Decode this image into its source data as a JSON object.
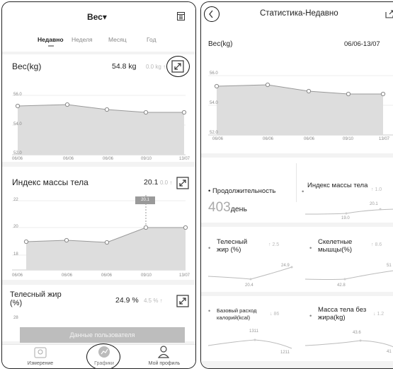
{
  "left": {
    "header": {
      "title": "Вес",
      "title_arrow": "▾"
    },
    "tabs": [
      {
        "label": "Недавно",
        "active": true
      },
      {
        "label": "Неделя",
        "active": false
      },
      {
        "label": "Месяц",
        "active": false
      },
      {
        "label": "Год",
        "active": false
      }
    ],
    "weight_card": {
      "title": "Вес(kg)",
      "value": "54.8 kg",
      "delta": "0.0 kg ↑",
      "y_ticks": [
        "56.0",
        "54.0",
        "52.0"
      ],
      "x_labels": [
        "06/06",
        "06/06",
        "06/06",
        "09/10",
        "13/07"
      ]
    },
    "bmi_card": {
      "title": "Индекс массы тела",
      "value": "20.1",
      "delta": "0.0 ↑",
      "tooltip": "20.1",
      "y_ticks": [
        "22",
        "20",
        "18"
      ],
      "x_labels": [
        "06/06",
        "06/06",
        "06/06",
        "09/10",
        "13/07"
      ]
    },
    "fat_card": {
      "title": "Телесный жир (%)",
      "value": "24.9 %",
      "delta": "4.5 % ↑",
      "y_tick": "28"
    },
    "user_data_button": "Данные пользователя",
    "bottom_nav": [
      {
        "label": "Измерение",
        "icon": "scale-icon"
      },
      {
        "label": "Графики",
        "icon": "chart-icon"
      },
      {
        "label": "Мой профиль",
        "icon": "person-icon"
      }
    ]
  },
  "right": {
    "header": {
      "title": "Статистика-Недавно"
    },
    "weight": {
      "title": "Вес(kg)",
      "range": "06/06-13/07",
      "y_ticks": [
        "56.0",
        "54.0",
        "52.0"
      ],
      "x_labels": [
        "06/06",
        "06/06",
        "06/06",
        "09/10",
        "13/07"
      ]
    },
    "duration": {
      "label": "Продолжительность",
      "value": "403",
      "unit": "день"
    },
    "bmi": {
      "label": "Индекс массы тела",
      "delta": "↑ 1.0",
      "v1": "20.1",
      "v2": "19.0"
    },
    "fat": {
      "label": "Телесный жир (%)",
      "delta": "↑ 2.5",
      "v1": "24.9",
      "v2": "20.4"
    },
    "skeletal": {
      "label": "Скелетные мышцы(%)",
      "delta": "↑ 8.6",
      "v1": "51",
      "v2": "42.8"
    },
    "bmr": {
      "label": "Базовый расход калорий(kcal)",
      "delta": "↓ 86",
      "v1": "1311",
      "v2": "1211"
    },
    "lean": {
      "label": "Масса тела без жира(kg)",
      "delta": "↓ 1.2",
      "v1": "43.6",
      "v2": "41"
    }
  },
  "colors": {
    "accent": "#333333",
    "grid": "#e5e5e5",
    "fill": "#dcdcdc",
    "line": "#9a9a9a",
    "bg": "#f3f3f3"
  }
}
